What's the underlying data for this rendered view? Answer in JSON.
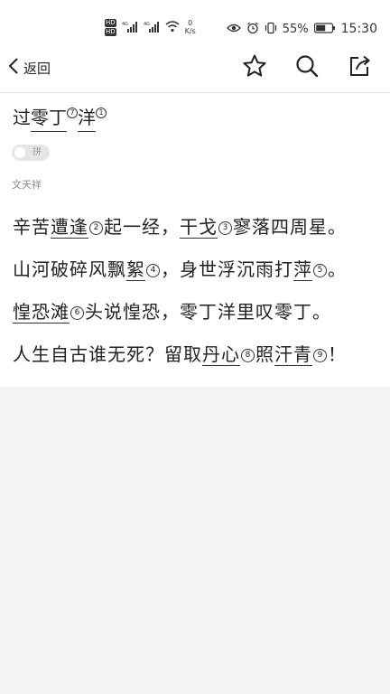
{
  "status_bar": {
    "sim1": "HD",
    "sim2": "HD",
    "net_speed_value": "0",
    "net_speed_unit": "K/s",
    "battery": "55%",
    "time": "15:30"
  },
  "nav": {
    "back_label": "返回",
    "actions": [
      "star-icon",
      "search-icon",
      "share-icon"
    ]
  },
  "poem": {
    "title": {
      "segments": [
        {
          "text": "过",
          "underline": false
        },
        {
          "text": "零丁",
          "underline": true,
          "note": "7"
        },
        {
          "text": " ",
          "underline": false
        },
        {
          "text": "洋",
          "underline": true,
          "note": "1"
        }
      ]
    },
    "pinyin_toggle_label": "拼",
    "author": "文天祥",
    "lines": [
      [
        {
          "text": "辛苦"
        },
        {
          "text": "遭逢",
          "underline": true,
          "note": "2"
        },
        {
          "text": "起一经，"
        },
        {
          "text": "干戈",
          "underline": true,
          "note": "3"
        },
        {
          "text": "寥落四周星。"
        }
      ],
      [
        {
          "text": "山河破碎风飘"
        },
        {
          "text": "絮",
          "underline": true,
          "note": "4"
        },
        {
          "text": "，身世浮沉雨打"
        },
        {
          "text": "萍",
          "underline": true,
          "note": "5"
        },
        {
          "text": "。"
        }
      ],
      [
        {
          "text": "惶恐滩",
          "underline": true,
          "note": "6"
        },
        {
          "text": "头说惶恐，零丁洋里叹零丁。"
        }
      ],
      [
        {
          "text": "人生自古谁无死？留取"
        },
        {
          "text": "丹心",
          "underline": true,
          "note": "8"
        },
        {
          "text": "照"
        },
        {
          "text": "汗青",
          "underline": true,
          "note": "9"
        },
        {
          "text": "！"
        }
      ]
    ]
  }
}
